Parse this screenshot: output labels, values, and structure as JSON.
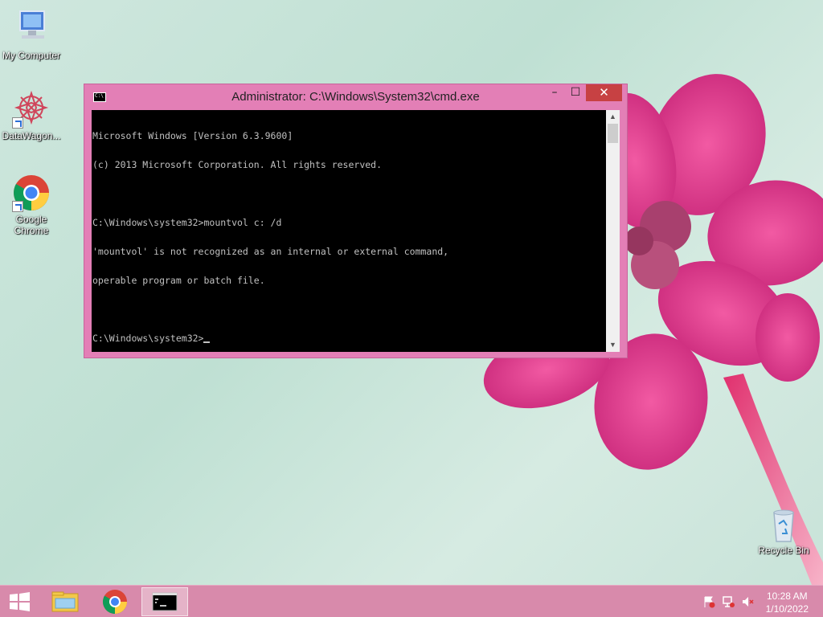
{
  "desktop": {
    "icons": [
      {
        "label": "My Computer"
      },
      {
        "label": "DataWagon..."
      },
      {
        "label_line1": "Google",
        "label_line2": "Chrome"
      },
      {
        "label": "Recycle Bin"
      }
    ]
  },
  "cmd": {
    "title": "Administrator: C:\\Windows\\System32\\cmd.exe",
    "buttons": {
      "minimize": "–",
      "maximize": "☐",
      "close": "✕"
    },
    "lines": [
      "Microsoft Windows [Version 6.3.9600]",
      "(c) 2013 Microsoft Corporation. All rights reserved.",
      "",
      "C:\\Windows\\system32>mountvol c: /d",
      "'mountvol' is not recognized as an internal or external command,",
      "operable program or batch file.",
      "",
      "C:\\Windows\\system32>"
    ]
  },
  "taskbar": {
    "items": [
      "start-icon",
      "file-explorer-icon",
      "chrome-icon",
      "cmd-icon"
    ],
    "clock": {
      "time": "10:28 AM",
      "date": "1/10/2022"
    }
  },
  "colors": {
    "window_frame": "#e37fb6",
    "close_button": "#c74143",
    "taskbar": "#d88aab"
  }
}
